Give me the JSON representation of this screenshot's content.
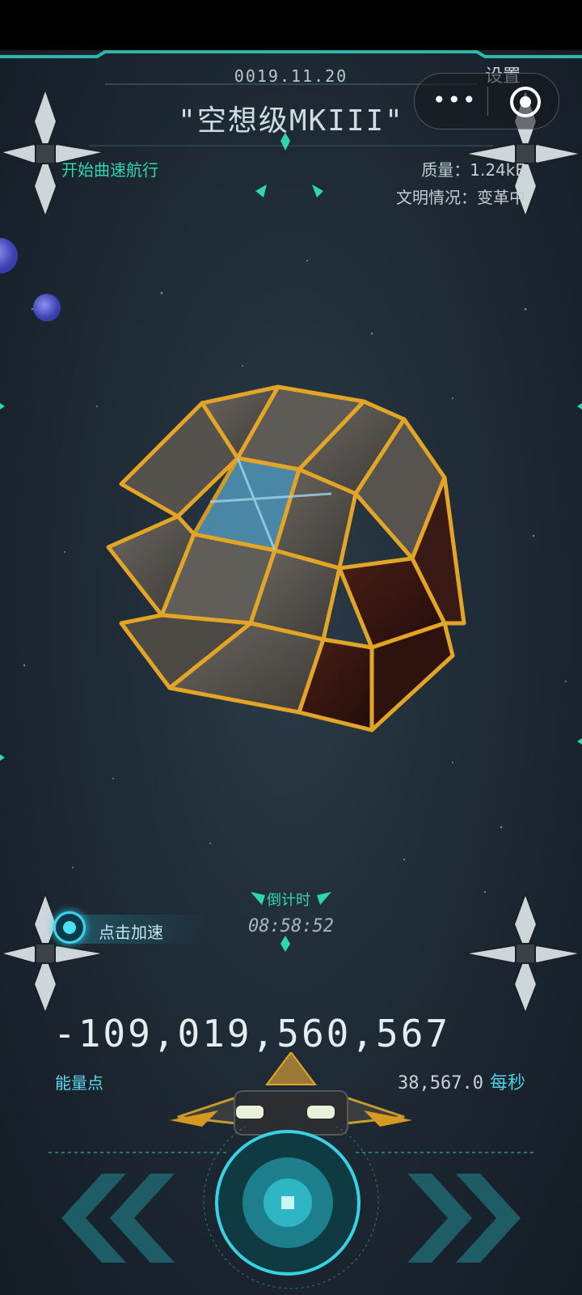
{
  "header": {
    "date": "0019.11.20",
    "ship_name": "\"空想级MKIII\"",
    "settings_label": "设置",
    "warp_status": "开始曲速航行",
    "mass": "质量：1.24kE",
    "civilization": "文明情况：变革中"
  },
  "boost": {
    "label": "点击加速"
  },
  "countdown": {
    "label": "倒计时",
    "time": "08:58:52"
  },
  "energy": {
    "value": "-109,019,560,567",
    "label": "能量点",
    "rate": "38,567.0",
    "rate_unit": "每秒"
  },
  "controls": {
    "left": "rewind-arrows",
    "center": "core-button",
    "right": "forward-arrows"
  },
  "icons": {
    "menu": "more-dots-icon",
    "close": "target-circle-icon",
    "drones": "satellite-drone-icon",
    "planets": "planet-icon"
  },
  "colors": {
    "accent": "#2fd6b0",
    "cyan": "#3ad6ea",
    "gold": "#e8a928",
    "background": "#1f2b36"
  }
}
